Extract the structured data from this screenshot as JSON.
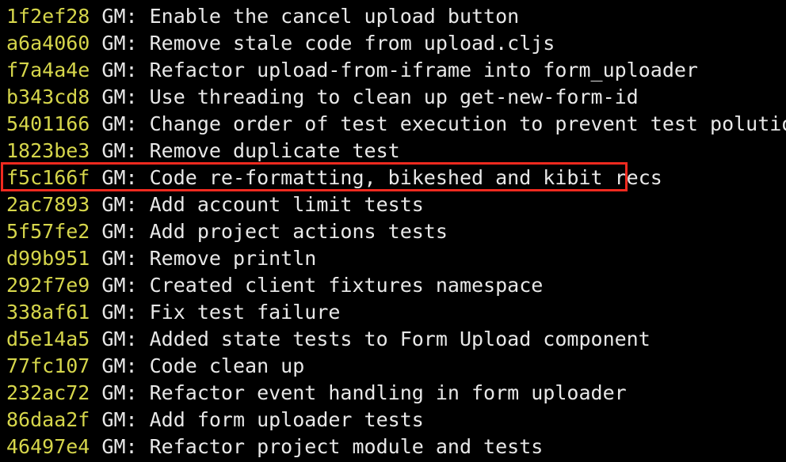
{
  "commits": [
    {
      "hash": "1f2ef28",
      "message": " GM: Enable the cancel upload button"
    },
    {
      "hash": "a6a4060",
      "message": " GM: Remove stale code from upload.cljs"
    },
    {
      "hash": "f7a4a4e",
      "message": " GM: Refactor upload-from-iframe into form_uploader"
    },
    {
      "hash": "b343cd8",
      "message": " GM: Use threading to clean up get-new-form-id"
    },
    {
      "hash": "5401166",
      "message": " GM: Change order of test execution to prevent test polution"
    },
    {
      "hash": "1823be3",
      "message": " GM: Remove duplicate test"
    },
    {
      "hash": "f5c166f",
      "message": " GM: Code re-formatting, bikeshed and kibit recs"
    },
    {
      "hash": "2ac7893",
      "message": " GM: Add account limit tests"
    },
    {
      "hash": "5f57fe2",
      "message": " GM: Add project actions tests"
    },
    {
      "hash": "d99b951",
      "message": " GM: Remove println"
    },
    {
      "hash": "292f7e9",
      "message": " GM: Created client fixtures namespace"
    },
    {
      "hash": "338af61",
      "message": " GM: Fix test failure"
    },
    {
      "hash": "d5e14a5",
      "message": " GM: Added state tests to Form Upload component"
    },
    {
      "hash": "77fc107",
      "message": " GM: Code clean up"
    },
    {
      "hash": "232ac72",
      "message": " GM: Refactor event handling in form uploader"
    },
    {
      "hash": "86daa2f",
      "message": " GM: Add form uploader tests"
    },
    {
      "hash": "46497e4",
      "message": " GM: Refactor project module and tests"
    }
  ],
  "colors": {
    "background": "#000000",
    "hash": "#d6d64b",
    "text": "#e8e8e8",
    "highlight": "#f02a1f"
  }
}
